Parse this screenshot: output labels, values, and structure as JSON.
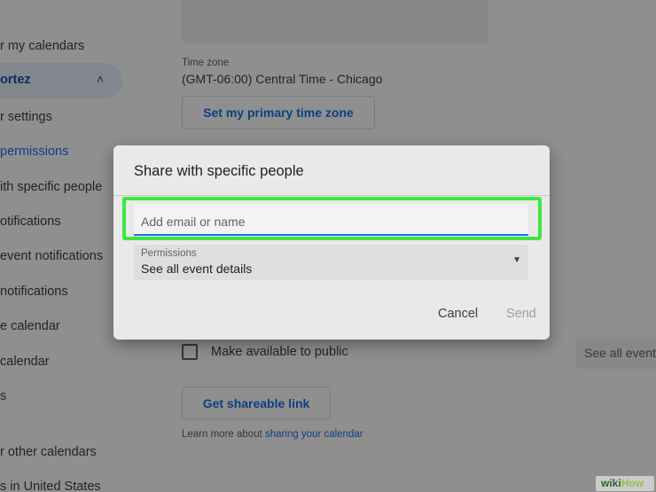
{
  "sidebar": {
    "header_my": "r my calendars",
    "active_calendar": "ortez",
    "items": [
      "r settings",
      "permissions",
      "ith specific people",
      "otifications",
      "event notifications",
      "notifications",
      "e calendar",
      " calendar",
      "s"
    ],
    "header_other": "r other calendars",
    "other_item": "s in United States"
  },
  "main": {
    "timezone_label": "Time zone",
    "timezone_value": "(GMT-06:00) Central Time - Chicago",
    "set_timezone_button": "Set my primary time zone",
    "public_label": "Make available to public",
    "public_select_value": "See all event",
    "shareable_link_button": "Get shareable link",
    "learn_more_text": "Learn more about ",
    "learn_more_link": "sharing your calendar"
  },
  "dialog": {
    "title": "Share with specific people",
    "email_placeholder": "Add email or name",
    "permissions_label": "Permissions",
    "permissions_value": "See all event details",
    "cancel_label": "Cancel",
    "send_label": "Send"
  },
  "watermark": {
    "part1": "wiki",
    "part2": "How"
  },
  "colors": {
    "accent": "#1a73e8",
    "highlight": "#3fe63f",
    "scrim": "rgba(0,0,0,0.44)"
  }
}
